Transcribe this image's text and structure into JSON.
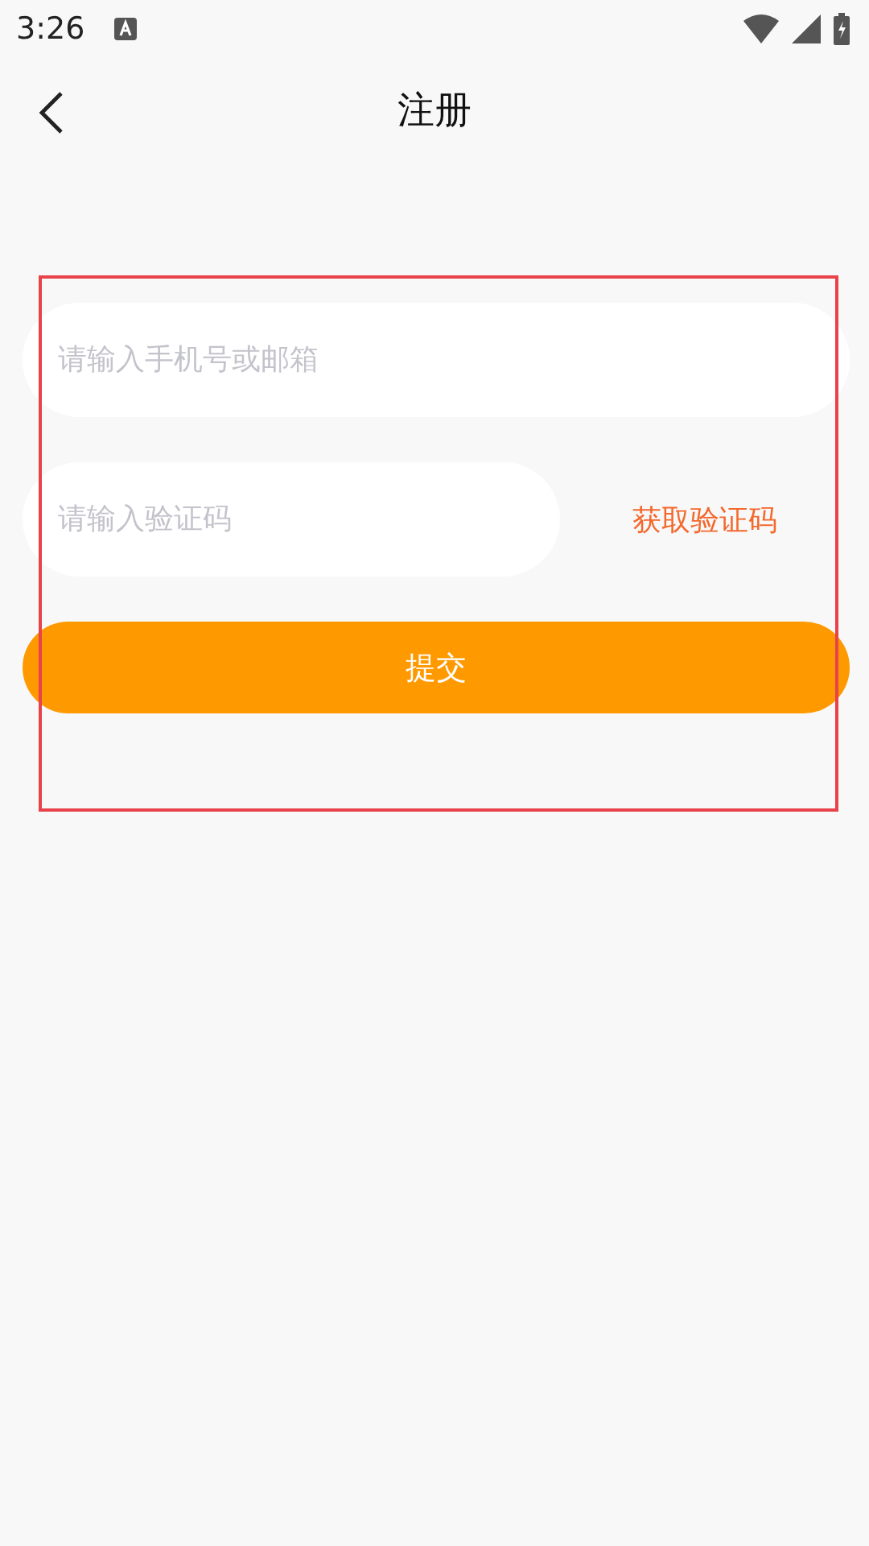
{
  "status_bar": {
    "time": "3:26"
  },
  "header": {
    "title": "注册"
  },
  "form": {
    "account_field": {
      "placeholder": "请输入手机号或邮箱"
    },
    "code_field": {
      "placeholder": "请输入验证码"
    },
    "get_code_link": "获取验证码",
    "submit_button": "提交"
  }
}
